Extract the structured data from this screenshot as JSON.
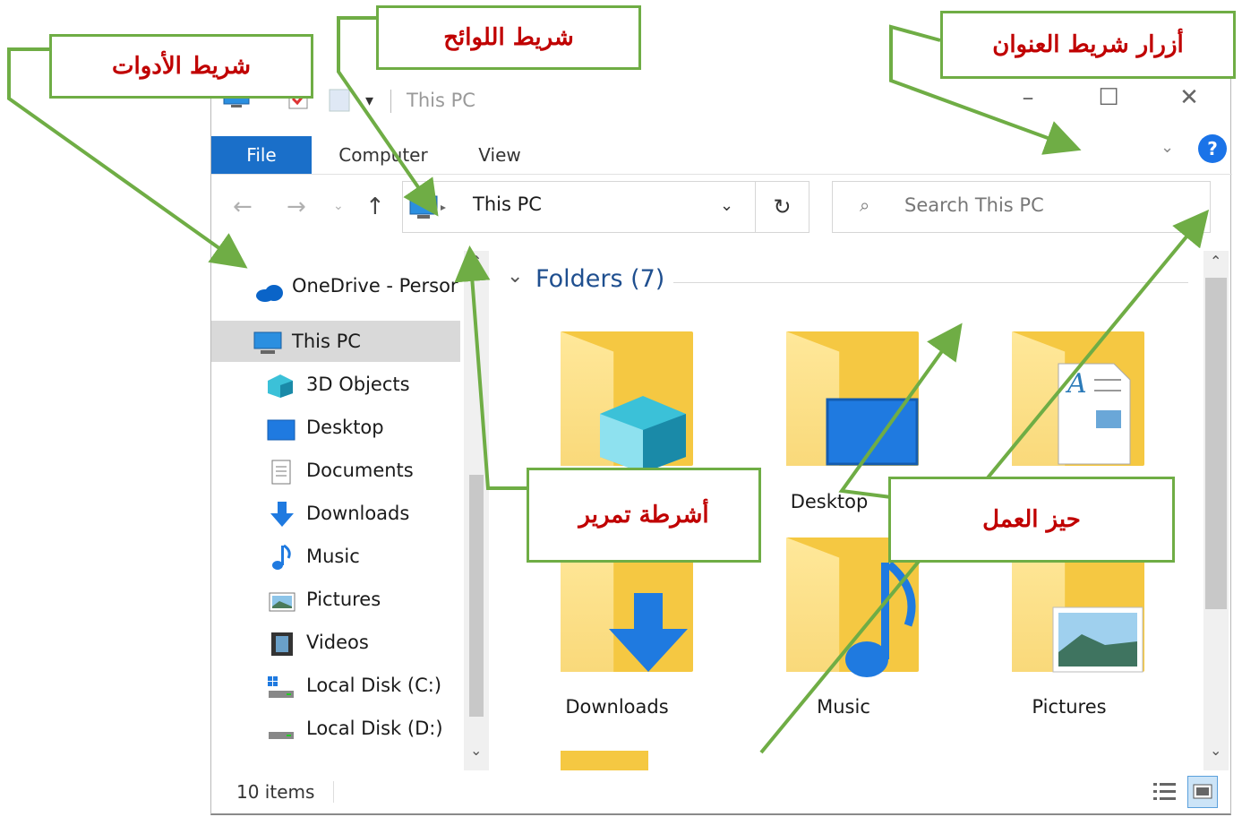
{
  "window": {
    "title": "This PC",
    "tabs": [
      "File",
      "Computer",
      "View"
    ],
    "address": "This PC",
    "search_placeholder": "Search This PC",
    "status_items": "10 items"
  },
  "nav_pane": {
    "items": [
      {
        "label": "OneDrive - Persor",
        "icon": "onedrive-icon"
      },
      {
        "label": "This PC",
        "icon": "computer-icon",
        "selected": true
      },
      {
        "label": "3D Objects",
        "icon": "3d-objects-icon"
      },
      {
        "label": "Desktop",
        "icon": "desktop-icon"
      },
      {
        "label": "Documents",
        "icon": "documents-icon"
      },
      {
        "label": "Downloads",
        "icon": "downloads-icon"
      },
      {
        "label": "Music",
        "icon": "music-icon"
      },
      {
        "label": "Pictures",
        "icon": "pictures-icon"
      },
      {
        "label": "Videos",
        "icon": "videos-icon"
      },
      {
        "label": "Local Disk (C:)",
        "icon": "local-disk-c-icon"
      },
      {
        "label": "Local Disk (D:)",
        "icon": "local-disk-d-icon"
      }
    ]
  },
  "content": {
    "section_header": "Folders (7)",
    "folders": [
      {
        "name": "",
        "icon": "3d-objects-icon"
      },
      {
        "name": "Desktop",
        "icon": "desktop-icon"
      },
      {
        "name": "",
        "icon": "documents-icon"
      },
      {
        "name": "Downloads",
        "icon": "downloads-icon"
      },
      {
        "name": "Music",
        "icon": "music-icon"
      },
      {
        "name": "Pictures",
        "icon": "pictures-icon"
      }
    ]
  },
  "annotations": {
    "toolbar": "شريط الأدوات",
    "tabs_bar": "شريط اللوائح",
    "address_buttons": "أزرار شريط العنوان",
    "scrollbars": "أشرطة تمرير",
    "workspace": "حيز العمل"
  },
  "colors": {
    "accent": "#1a6fc9",
    "annotation_border": "#6fad45",
    "annotation_text": "#c00000",
    "folder_yellow": "#f5c842"
  }
}
